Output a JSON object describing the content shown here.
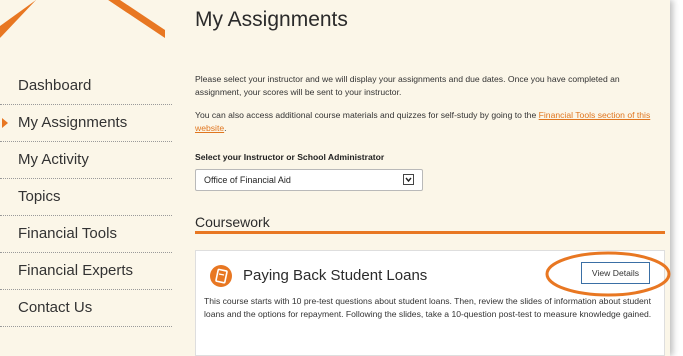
{
  "sidebar": {
    "items": [
      {
        "label": "Dashboard",
        "active": false
      },
      {
        "label": "My Assignments",
        "active": true
      },
      {
        "label": "My Activity",
        "active": false
      },
      {
        "label": "Topics",
        "active": false
      },
      {
        "label": "Financial Tools",
        "active": false
      },
      {
        "label": "Financial Experts",
        "active": false
      },
      {
        "label": "Contact Us",
        "active": false
      }
    ]
  },
  "main": {
    "title": "My Assignments",
    "intro": "Please select your instructor and we will display your assignments and due dates. Once you have completed an assignment, your scores will be sent to your instructor.",
    "more_prefix": "You can also access additional course materials and quizzes for self-study by going to the ",
    "more_link": "Financial Tools section of this website",
    "more_suffix": ".",
    "select_label": "Select your Instructor or School Administrator",
    "select_value": "Office of Financial Aid",
    "section_title": "Coursework"
  },
  "course": {
    "title": "Paying Back Student Loans",
    "button": "View Details",
    "description": "This course starts with 10 pre-test questions about student loans. Then, review the slides of information about student loans and the options for repayment. Following the slides, take a 10-question post-test to measure knowledge gained."
  },
  "colors": {
    "accent": "#e87722",
    "annotation": "#e87722",
    "button_border": "#3a6fa5",
    "page_bg": "#fbf6e8"
  }
}
